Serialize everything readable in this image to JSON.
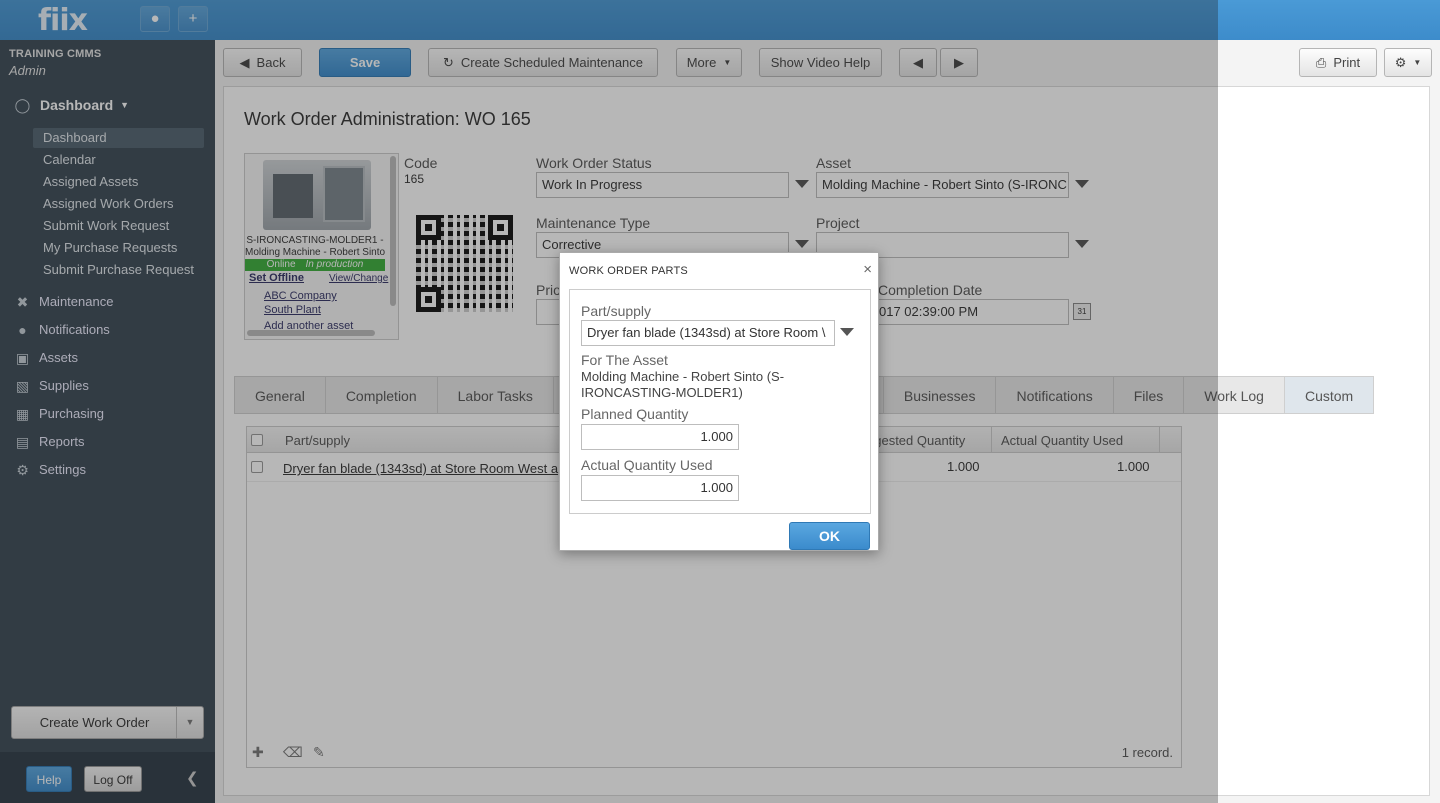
{
  "app": {
    "logo": "fiix",
    "user_icon": "user-icon",
    "add_icon": "plus-icon"
  },
  "sidebar": {
    "org": "TRAINING CMMS",
    "role": "Admin",
    "dashboard_label": "Dashboard",
    "sub_items": [
      "Dashboard",
      "Calendar",
      "Assigned Assets",
      "Assigned Work Orders",
      "Submit Work Request",
      "My Purchase Requests",
      "Submit Purchase Request"
    ],
    "items": [
      "Maintenance",
      "Notifications",
      "Assets",
      "Supplies",
      "Purchasing",
      "Reports",
      "Settings"
    ],
    "create_work_order": "Create Work Order",
    "help": "Help",
    "log_off": "Log Off"
  },
  "toolbar": {
    "back": "Back",
    "save": "Save",
    "create_scheduled": "Create Scheduled Maintenance",
    "more": "More",
    "video_help": "Show Video Help",
    "print": "Print"
  },
  "work_order": {
    "title": "Work Order Administration: WO 165",
    "asset_code": "S-IRONCASTING-MOLDER1 -",
    "asset_name": "Molding Machine - Robert Sinto",
    "status_online": "Online",
    "status_production": "In production",
    "set_offline": "Set Offline",
    "view_change": "View/Change",
    "company": "ABC Company",
    "plant": "South Plant",
    "add_asset": "Add another asset",
    "code_label": "Code",
    "code_value": "165",
    "status_label": "Work Order Status",
    "status_value": "Work In Progress",
    "asset_label": "Asset",
    "asset_value": "Molding Machine - Robert Sinto (S-IRONC",
    "maint_type_label": "Maintenance Type",
    "maint_type_value": "Corrective",
    "project_label": "Project",
    "project_value": "",
    "priority_label": "Prio",
    "completion_label": "Completion Date",
    "completion_value": "017 02:39:00 PM"
  },
  "tabs": [
    "General",
    "Completion",
    "Labor Tasks",
    "",
    "Businesses",
    "Notifications",
    "Files",
    "Work Log",
    "Custom"
  ],
  "grid": {
    "col_part": "Part/supply",
    "col_suggested": "ggested Quantity",
    "col_actual": "Actual Quantity Used",
    "row_part": "Dryer fan blade (1343sd) at Store Room West a",
    "row_suggested": "1.000",
    "row_actual": "1.000",
    "records": "1 record."
  },
  "dialog": {
    "title": "WORK ORDER PARTS",
    "part_label": "Part/supply",
    "part_value": "Dryer fan blade (1343sd) at Store Room \\",
    "asset_label": "For The Asset",
    "asset_value": "Molding Machine - Robert Sinto (S-IRONCASTING-MOLDER1)",
    "planned_label": "Planned Quantity",
    "planned_value": "1.000",
    "actual_label": "Actual Quantity Used",
    "actual_value": "1.000",
    "ok": "OK"
  }
}
